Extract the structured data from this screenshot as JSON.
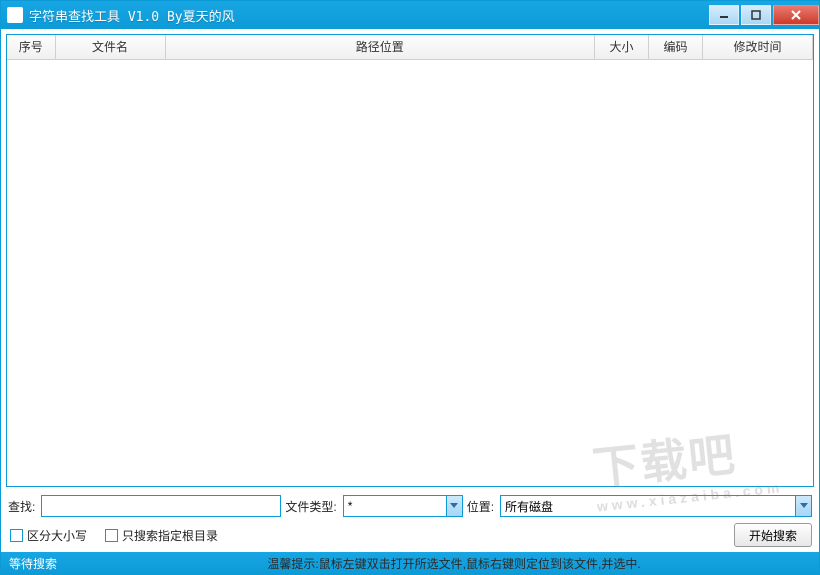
{
  "window": {
    "title": "字符串查找工具 V1.0 By夏天的风"
  },
  "columns": {
    "c0": "序号",
    "c1": "文件名",
    "c2": "路径位置",
    "c3": "大小",
    "c4": "编码",
    "c5": "修改时间"
  },
  "labels": {
    "search": "查找:",
    "filetype": "文件类型:",
    "location": "位置:",
    "case_sensitive": "区分大小写",
    "root_only": "只搜索指定根目录",
    "start_button": "开始搜索"
  },
  "combos": {
    "filetype_value": "*",
    "location_value": "所有磁盘"
  },
  "status": {
    "state": "等待搜索",
    "tip": "温馨提示:鼠标左键双击打开所选文件,鼠标右键则定位到该文件,并选中."
  },
  "watermark": {
    "main": "下载吧",
    "sub": "www.xiazaiba.com"
  }
}
